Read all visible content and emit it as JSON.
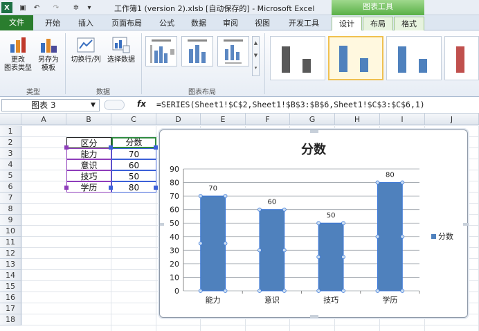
{
  "window": {
    "title": "工作簿1 (version 2).xlsb [自动保存的] - Microsoft Excel",
    "context_header": "图表工具"
  },
  "tabs": [
    "文件",
    "开始",
    "插入",
    "页面布局",
    "公式",
    "数据",
    "审阅",
    "视图",
    "开发工具",
    "设计",
    "布局",
    "格式"
  ],
  "ribbon": {
    "change_type_label": "更改\n图表类型",
    "save_template_label": "另存为\n模板",
    "switch_row_col_label": "切换行/列",
    "select_data_label": "选择数据",
    "group_type": "类型",
    "group_data": "数据",
    "group_layout": "图表布局"
  },
  "formula_bar": {
    "name_box": "图表 3",
    "fx": "fx",
    "formula": "=SERIES(Sheet1!$C$2,Sheet1!$B$3:$B$6,Sheet1!$C$3:$C$6,1)"
  },
  "columns": [
    "A",
    "B",
    "C",
    "D",
    "E",
    "F",
    "G",
    "H",
    "I",
    "J"
  ],
  "rows": [
    "1",
    "2",
    "3",
    "4",
    "5",
    "6",
    "7",
    "8",
    "9",
    "10",
    "11",
    "12",
    "13",
    "14",
    "15",
    "16",
    "17",
    "18"
  ],
  "table": {
    "header": [
      "区分",
      "分数"
    ],
    "rows": [
      [
        "能力",
        "70"
      ],
      [
        "意识",
        "60"
      ],
      [
        "技巧",
        "50"
      ],
      [
        "学历",
        "80"
      ]
    ]
  },
  "chart_data": {
    "type": "bar",
    "title": "分数",
    "categories": [
      "能力",
      "意识",
      "技巧",
      "学历"
    ],
    "series": [
      {
        "name": "分数",
        "values": [
          70,
          60,
          50,
          80
        ]
      }
    ],
    "ylim": [
      0,
      90
    ],
    "yticks": [
      "0",
      "10",
      "20",
      "30",
      "40",
      "50",
      "60",
      "70",
      "80",
      "90"
    ],
    "grid": true,
    "legend": "right",
    "data_labels": [
      "70",
      "60",
      "50",
      "80"
    ],
    "bar_color": "#4f81bd"
  },
  "colors": {
    "file_tab": "#2a7d2e",
    "context_tab": "#59b046",
    "bar": "#4f81bd"
  }
}
